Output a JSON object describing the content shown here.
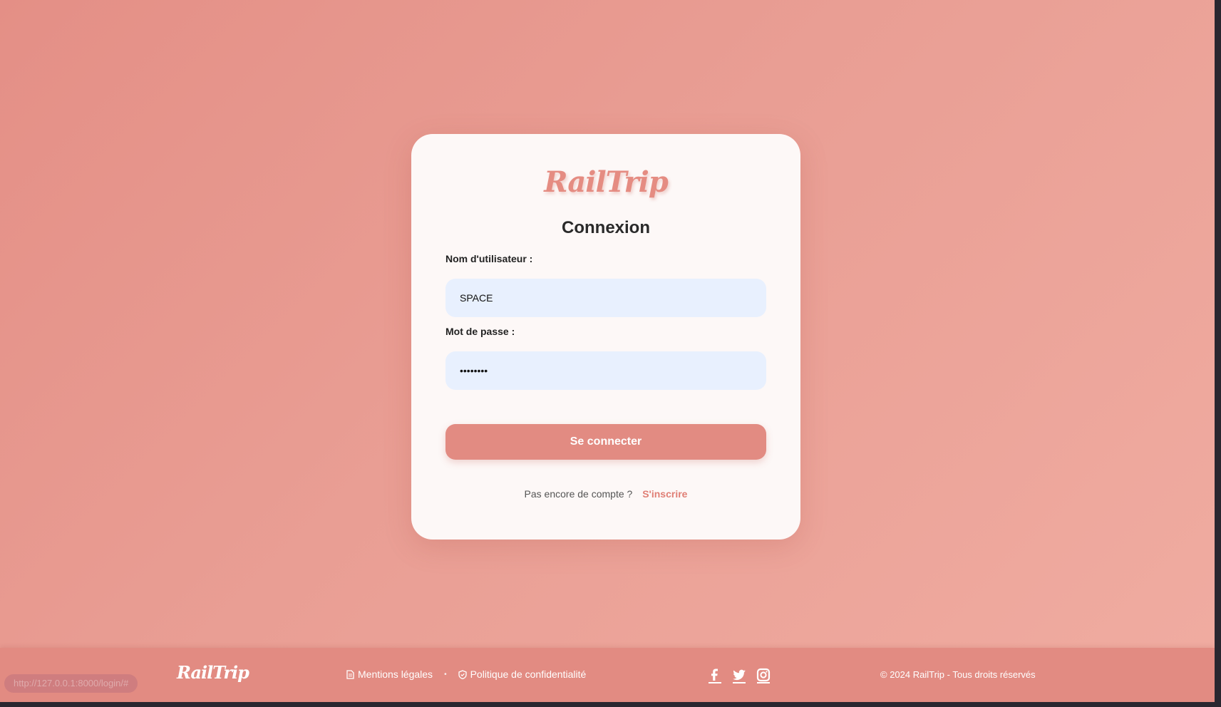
{
  "card": {
    "logo": "RailTrip",
    "title": "Connexion",
    "username_label": "Nom d'utilisateur :",
    "username_value": "SPACE",
    "password_label": "Mot de passe :",
    "password_value": "password",
    "submit_label": "Se connecter",
    "signup_prompt": "Pas encore de compte ?",
    "signup_link": "S'inscrire"
  },
  "footer": {
    "logo": "RailTrip",
    "links": [
      "Mentions légales",
      "Politique de confidentialité"
    ],
    "separator": "•",
    "social_icons": [
      "facebook-icon",
      "twitter-icon",
      "instagram-icon"
    ],
    "copyright": "© 2024 RailTrip - Tous droits réservés"
  },
  "status_bar": {
    "url": "http://127.0.0.1:8000/login/#"
  },
  "colors": {
    "accent": "#e28b82",
    "input_bg": "#e8f0fe",
    "card_bg": "#fdf8f7"
  }
}
